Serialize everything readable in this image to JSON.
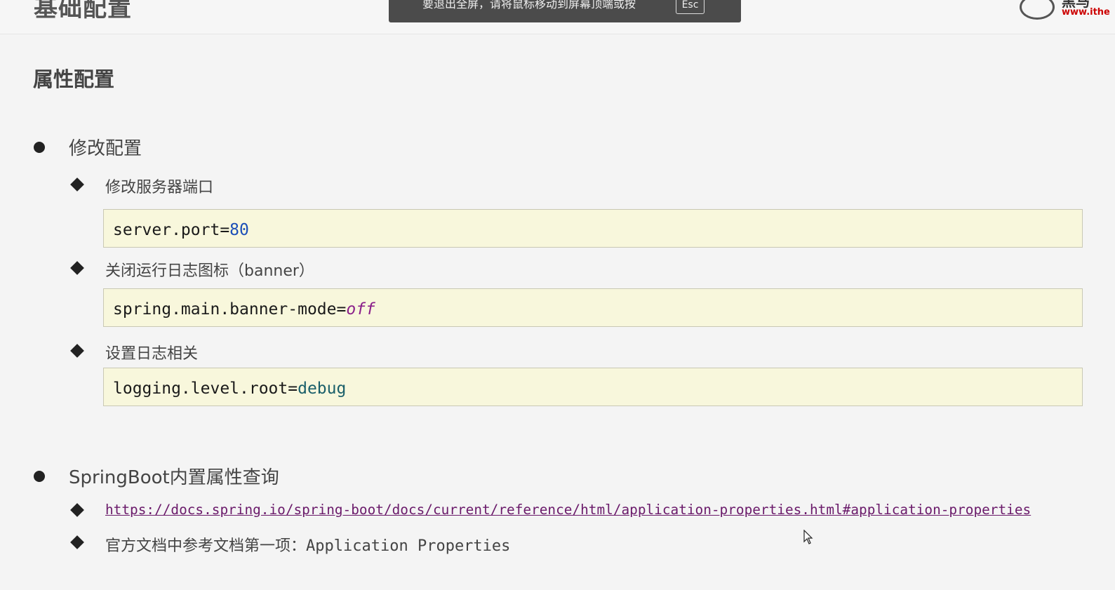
{
  "header": {
    "page_title": "基础配置",
    "fullscreen_message": "要退出全屏，请将鼠标移动到屏幕顶端或按",
    "fullscreen_key": "Esc",
    "logo_brand": "黑马",
    "logo_url": "www.ithe"
  },
  "content": {
    "section_title": "属性配置",
    "items": [
      {
        "label": "修改配置",
        "subitems": [
          {
            "label": "修改服务器端口",
            "code_key": "server.port=",
            "code_value": "80"
          },
          {
            "label": "关闭运行日志图标（banner）",
            "code_key": "spring.main.banner-mode=",
            "code_value": "off"
          },
          {
            "label": "设置日志相关",
            "code_key": "logging.level.root=",
            "code_value": "debug"
          }
        ]
      },
      {
        "label": "SpringBoot内置属性查询",
        "subitems": [
          {
            "link": "https://docs.spring.io/spring-boot/docs/current/reference/html/application-properties.html#application-properties"
          },
          {
            "label_prefix": "官方文档中参考文档第一项：",
            "label_suffix": "Application Properties"
          }
        ]
      }
    ]
  },
  "icons": {
    "cursor": "mouse-pointer-icon",
    "bullet": "filled-circle",
    "sub_bullet": "filled-diamond"
  },
  "colors": {
    "code_bg": "#f8f7dc",
    "number": "#1c4fb8",
    "keyword": "#8a1f8a",
    "link": "#6a1a6a"
  }
}
